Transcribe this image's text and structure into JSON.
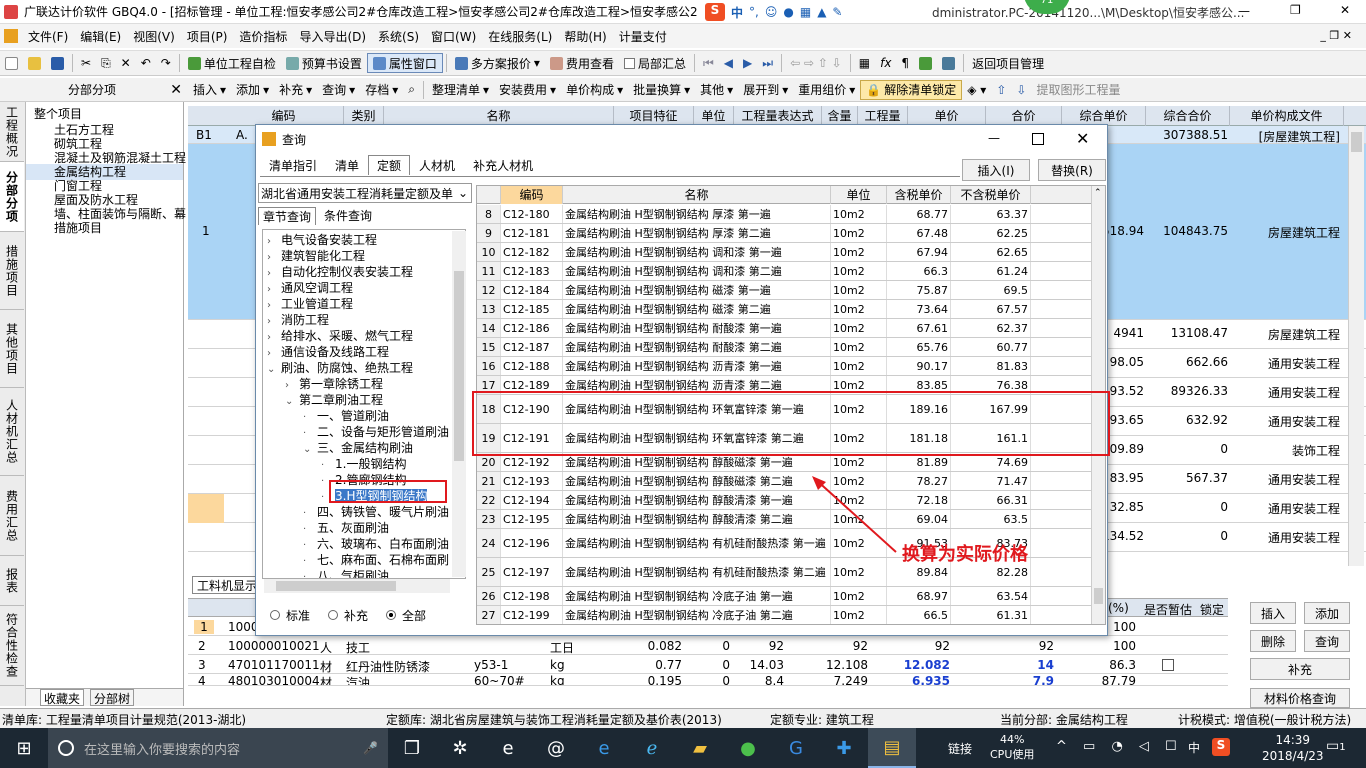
{
  "titlebar": {
    "text": "广联达计价软件 GBQ4.0 - [招标管理 - 单位工程:恒安孝感公司2#仓库改造工程>恒安孝感公司2#仓库改造工程>恒安孝感公2",
    "path_right": "dministrator.PC-20141120...\\M\\Desktop\\恒安孝感公...",
    "badge": "71",
    "ime": "中"
  },
  "menu": [
    "文件(F)",
    "编辑(E)",
    "视图(V)",
    "项目(P)",
    "造价指标",
    "导入导出(D)",
    "系统(S)",
    "窗口(W)",
    "在线服务(L)",
    "帮助(H)",
    "计量支付"
  ],
  "toolbar1": {
    "selfcheck": "单位工程自检",
    "preview": "预算书设置",
    "attrwin": "属性窗口",
    "multi": "多方案报价",
    "feeview": "费用查看",
    "partial": "局部汇总",
    "back": "返回项目管理"
  },
  "toolbar2": {
    "insert": "插入",
    "add": "添加",
    "supplement": "补充",
    "query": "查询",
    "save": "存档",
    "organize": "整理清单",
    "install_fee": "安装费用",
    "unit_comp": "单价构成",
    "batch": "批量换算",
    "other": "其他",
    "expand": "展开到",
    "reprice": "重用组价",
    "unlock": "解除清单锁定",
    "extract": "提取图形工程量"
  },
  "vtabs": [
    "工程概况",
    "分部分项",
    "措施项目",
    "其他项目",
    "人材机汇总",
    "费用汇总",
    "报表",
    "符合性检查"
  ],
  "tree": {
    "title": "分部分项",
    "root": "整个项目",
    "items": [
      "土石方工程",
      "砌筑工程",
      "混凝土及钢筋混凝土工程",
      "金属结构工程",
      "门窗工程",
      "屋面及防水工程",
      "墙、柱面装饰与隔断、幕",
      "措施项目"
    ],
    "bottom_tabs": [
      "收藏夹",
      "分部树"
    ]
  },
  "grid": {
    "headers": [
      "编码",
      "类别",
      "名称",
      "项目特征",
      "单位",
      "工程量表达式",
      "含量",
      "工程量",
      "单价",
      "合价",
      "综合单价",
      "综合合价",
      "单价构成文件"
    ],
    "rows": [
      {
        "no": "B1",
        "code": "A.",
        "zhdj": "",
        "zhhj": "307388.51",
        "file": "[房屋建筑工程]"
      },
      {
        "no": "1",
        "code": "",
        "zhdj": "518.94",
        "zhhj": "104843.75",
        "file": "房屋建筑工程"
      },
      {
        "no": "",
        "code": "",
        "zhdj": "4941",
        "zhhj": "13108.47",
        "file": "房屋建筑工程"
      },
      {
        "no": "",
        "code": "",
        "zhdj": "98.05",
        "zhhj": "662.66",
        "file": "通用安装工程"
      },
      {
        "no": "",
        "code": "",
        "zhdj": "193.52",
        "zhhj": "89326.33",
        "file": "通用安装工程"
      },
      {
        "no": "",
        "code": "",
        "zhdj": "93.65",
        "zhhj": "632.92",
        "file": "通用安装工程"
      },
      {
        "no": "",
        "code": "",
        "zhdj": "409.89",
        "zhhj": "0",
        "file": "装饰工程"
      },
      {
        "no": "",
        "code": "",
        "zhdj": "83.95",
        "zhhj": "567.37",
        "file": "通用安装工程"
      },
      {
        "no": "",
        "code": "",
        "zhdj": "32.85",
        "zhhj": "0",
        "file": "通用安装工程"
      },
      {
        "no": "",
        "code": "",
        "zhdj": "134.52",
        "zhhj": "0",
        "file": "通用安装工程"
      }
    ]
  },
  "lower": {
    "tab": "工料机显示",
    "headers": [
      "(%)",
      "是否暂估",
      "锁定"
    ],
    "rows": [
      {
        "no": "1",
        "code": "10000",
        "type": "",
        "name": "",
        "spec": "",
        "unit": "",
        "q1": "",
        "q2": "",
        "p1": "",
        "p2": "",
        "p3": "",
        "p4": "",
        "pct": "100"
      },
      {
        "no": "2",
        "code": "100000010021",
        "type": "人",
        "name": "技工",
        "spec": "",
        "unit": "工日",
        "q1": "0.082",
        "q2": "0",
        "p1": "92",
        "p2": "92",
        "p3": "92",
        "p4": "92",
        "pct": "100"
      },
      {
        "no": "3",
        "code": "470101170011",
        "type": "材",
        "name": "红丹油性防锈漆",
        "spec": "y53-1",
        "unit": "kg",
        "q1": "0.77",
        "q2": "0",
        "p1": "14.03",
        "p2": "12.108",
        "p3": "12.082",
        "p4": "14",
        "pct": "86.3"
      },
      {
        "no": "4",
        "code": "480103010004",
        "type": "材",
        "name": "汽油",
        "spec": "60~70#",
        "unit": "kg",
        "q1": "0.195",
        "q2": "0",
        "p1": "8.4",
        "p2": "7.249",
        "p3": "6.935",
        "p4": "7.9",
        "pct": "87.79"
      }
    ]
  },
  "right_buttons": {
    "insert": "插入",
    "add": "添加",
    "delete": "删除",
    "query": "查询",
    "supplement": "补充",
    "material": "材料价格查询"
  },
  "dialog": {
    "title": "查询",
    "tabs": [
      "清单指引",
      "清单",
      "定额",
      "人材机",
      "补充人材机"
    ],
    "active_tab": "定额",
    "insert_btn": "插入(I)",
    "replace_btn": "替换(R)",
    "library": "湖北省通用安装工程消耗量定额及单",
    "subtabs": [
      "章节查询",
      "条件查询"
    ],
    "tree": [
      {
        "t": "电气设备安装工程",
        "lvl": 0,
        "exp": ">"
      },
      {
        "t": "建筑智能化工程",
        "lvl": 0,
        "exp": ">"
      },
      {
        "t": "自动化控制仪表安装工程",
        "lvl": 0,
        "exp": ">"
      },
      {
        "t": "通风空调工程",
        "lvl": 0,
        "exp": ">"
      },
      {
        "t": "工业管道工程",
        "lvl": 0,
        "exp": ">"
      },
      {
        "t": "消防工程",
        "lvl": 0,
        "exp": ">"
      },
      {
        "t": "给排水、采暖、燃气工程",
        "lvl": 0,
        "exp": ">"
      },
      {
        "t": "通信设备及线路工程",
        "lvl": 0,
        "exp": ">"
      },
      {
        "t": "刷油、防腐蚀、绝热工程",
        "lvl": 0,
        "exp": "v"
      },
      {
        "t": "第一章除锈工程",
        "lvl": 1,
        "exp": ">"
      },
      {
        "t": "第二章刷油工程",
        "lvl": 1,
        "exp": "v"
      },
      {
        "t": "一、管道刷油",
        "lvl": 2,
        "exp": ""
      },
      {
        "t": "二、设备与矩形管道刷油",
        "lvl": 2,
        "exp": ""
      },
      {
        "t": "三、金属结构刷油",
        "lvl": 2,
        "exp": "v"
      },
      {
        "t": "1.一般钢结构",
        "lvl": 3,
        "exp": ""
      },
      {
        "t": "2.管廊钢结构",
        "lvl": 3,
        "exp": ""
      },
      {
        "t": "3.H型钢制钢结构",
        "lvl": 3,
        "exp": "",
        "sel": true
      },
      {
        "t": "四、铸铁管、暖气片刷油",
        "lvl": 2,
        "exp": ""
      },
      {
        "t": "五、灰面刷油",
        "lvl": 2,
        "exp": ""
      },
      {
        "t": "六、玻璃布、白布面刷油",
        "lvl": 2,
        "exp": ""
      },
      {
        "t": "七、麻布面、石棉布面刷",
        "lvl": 2,
        "exp": ""
      },
      {
        "t": "八、气柜刷油",
        "lvl": 2,
        "exp": ""
      }
    ],
    "radios": [
      "标准",
      "补充",
      "全部"
    ],
    "radio_selected": "全部",
    "headers": [
      "",
      "编码",
      "名称",
      "单位",
      "含税单价",
      "不含税单价"
    ],
    "rows": [
      {
        "n": "8",
        "code": "C12-180",
        "name": "金属结构刷油 H型钢制钢结构 厚漆 第一遍",
        "unit": "10m2",
        "p1": "68.77",
        "p2": "63.37"
      },
      {
        "n": "9",
        "code": "C12-181",
        "name": "金属结构刷油 H型钢制钢结构 厚漆 第二遍",
        "unit": "10m2",
        "p1": "67.48",
        "p2": "62.25"
      },
      {
        "n": "10",
        "code": "C12-182",
        "name": "金属结构刷油 H型钢制钢结构 调和漆 第一遍",
        "unit": "10m2",
        "p1": "67.94",
        "p2": "62.65"
      },
      {
        "n": "11",
        "code": "C12-183",
        "name": "金属结构刷油 H型钢制钢结构 调和漆 第二遍",
        "unit": "10m2",
        "p1": "66.3",
        "p2": "61.24"
      },
      {
        "n": "12",
        "code": "C12-184",
        "name": "金属结构刷油 H型钢制钢结构 磁漆 第一遍",
        "unit": "10m2",
        "p1": "75.87",
        "p2": "69.5"
      },
      {
        "n": "13",
        "code": "C12-185",
        "name": "金属结构刷油 H型钢制钢结构 磁漆 第二遍",
        "unit": "10m2",
        "p1": "73.64",
        "p2": "67.57"
      },
      {
        "n": "14",
        "code": "C12-186",
        "name": "金属结构刷油 H型钢制钢结构 耐酸漆 第一遍",
        "unit": "10m2",
        "p1": "67.61",
        "p2": "62.37"
      },
      {
        "n": "15",
        "code": "C12-187",
        "name": "金属结构刷油 H型钢制钢结构 耐酸漆 第二遍",
        "unit": "10m2",
        "p1": "65.76",
        "p2": "60.77"
      },
      {
        "n": "16",
        "code": "C12-188",
        "name": "金属结构刷油 H型钢制钢结构 沥青漆 第一遍",
        "unit": "10m2",
        "p1": "90.17",
        "p2": "81.83"
      },
      {
        "n": "17",
        "code": "C12-189",
        "name": "金属结构刷油 H型钢制钢结构 沥青漆 第二遍",
        "unit": "10m2",
        "p1": "83.85",
        "p2": "76.38"
      },
      {
        "n": "18",
        "code": "C12-190",
        "name": "金属结构刷油 H型钢制钢结构 环氧富锌漆 第一遍",
        "unit": "10m2",
        "p1": "189.16",
        "p2": "167.99",
        "tall": true
      },
      {
        "n": "19",
        "code": "C12-191",
        "name": "金属结构刷油 H型钢制钢结构 环氧富锌漆 第二遍",
        "unit": "10m2",
        "p1": "181.18",
        "p2": "161.1",
        "tall": true
      },
      {
        "n": "20",
        "code": "C12-192",
        "name": "金属结构刷油 H型钢制钢结构 醇酸磁漆 第一遍",
        "unit": "10m2",
        "p1": "81.89",
        "p2": "74.69"
      },
      {
        "n": "21",
        "code": "C12-193",
        "name": "金属结构刷油 H型钢制钢结构 醇酸磁漆 第二遍",
        "unit": "10m2",
        "p1": "78.27",
        "p2": "71.47"
      },
      {
        "n": "22",
        "code": "C12-194",
        "name": "金属结构刷油 H型钢制钢结构 醇酸清漆 第一遍",
        "unit": "10m2",
        "p1": "72.18",
        "p2": "66.31"
      },
      {
        "n": "23",
        "code": "C12-195",
        "name": "金属结构刷油 H型钢制钢结构 醇酸清漆 第二遍",
        "unit": "10m2",
        "p1": "69.04",
        "p2": "63.5"
      },
      {
        "n": "24",
        "code": "C12-196",
        "name": "金属结构刷油 H型钢制钢结构 有机硅耐酸热漆 第一遍",
        "unit": "10m2",
        "p1": "91.53",
        "p2": "83.73",
        "tall": true
      },
      {
        "n": "25",
        "code": "C12-197",
        "name": "金属结构刷油 H型钢制钢结构 有机硅耐酸热漆 第二遍",
        "unit": "10m2",
        "p1": "89.84",
        "p2": "82.28",
        "tall": true
      },
      {
        "n": "26",
        "code": "C12-198",
        "name": "金属结构刷油 H型钢制钢结构 冷底子油 第一遍",
        "unit": "10m2",
        "p1": "68.97",
        "p2": "63.54"
      },
      {
        "n": "27",
        "code": "C12-199",
        "name": "金属结构刷油 H型钢制钢结构 冷底子油 第二遍",
        "unit": "10m2",
        "p1": "66.5",
        "p2": "61.31"
      }
    ]
  },
  "annotation": {
    "text": "换算为实际价格",
    "color": "#e0191e"
  },
  "status": {
    "s1": "清单库: 工程量清单项目计量规范(2013-湖北)",
    "s2": "定额库: 湖北省房屋建筑与装饰工程消耗量定额及基价表(2013)",
    "s3": "定额专业: 建筑工程",
    "s4": "当前分部: 金属结构工程",
    "s5": "计税模式: 增值税(一般计税方法)"
  },
  "taskbar": {
    "search": "在这里输入你要搜索的内容",
    "link": "链接",
    "cpu": "44%",
    "cpu_label": "CPU使用",
    "ime": "中",
    "time": "14:39",
    "date": "2018/4/23",
    "notif": "1"
  },
  "colors": {
    "accent": "#3a78c8",
    "grid_blue": "#aad4f5",
    "highlight": "#fcd89d",
    "red": "#e0191e"
  }
}
